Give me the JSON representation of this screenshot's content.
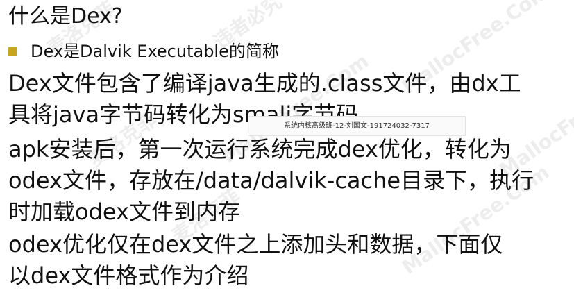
{
  "slide": {
    "title": "什么是Dex?",
    "bullet": "Dex是Dalvik Executable的简称",
    "paragraph1": {
      "line1": "Dex文件包含了编译java生成的.class文件，由dx工",
      "line2": "具将java字节码转化为smali字节码"
    },
    "paragraph2": {
      "line1": "apk安装后，第一次运行系统完成dex优化，转化为",
      "line2": "odex文件，存放在/data/dalvik-cache目录下，执行",
      "line3": "时加载odex文件到内存"
    },
    "paragraph3": {
      "line1": "odex优化仅在dex文件之上添加头和数据，下面仅",
      "line2": "以dex文件格式作为介绍"
    }
  },
  "overlay": {
    "caption": "系统内核高级班-12-刘国文-191724032-7317"
  },
  "watermarks": {
    "text_a": "MallocFree.Com",
    "text_b": "麦洛克菲",
    "text_c": "违者必究"
  },
  "colors": {
    "bullet": "#c8a51e",
    "text": "#111111",
    "background": "#ffffff"
  }
}
